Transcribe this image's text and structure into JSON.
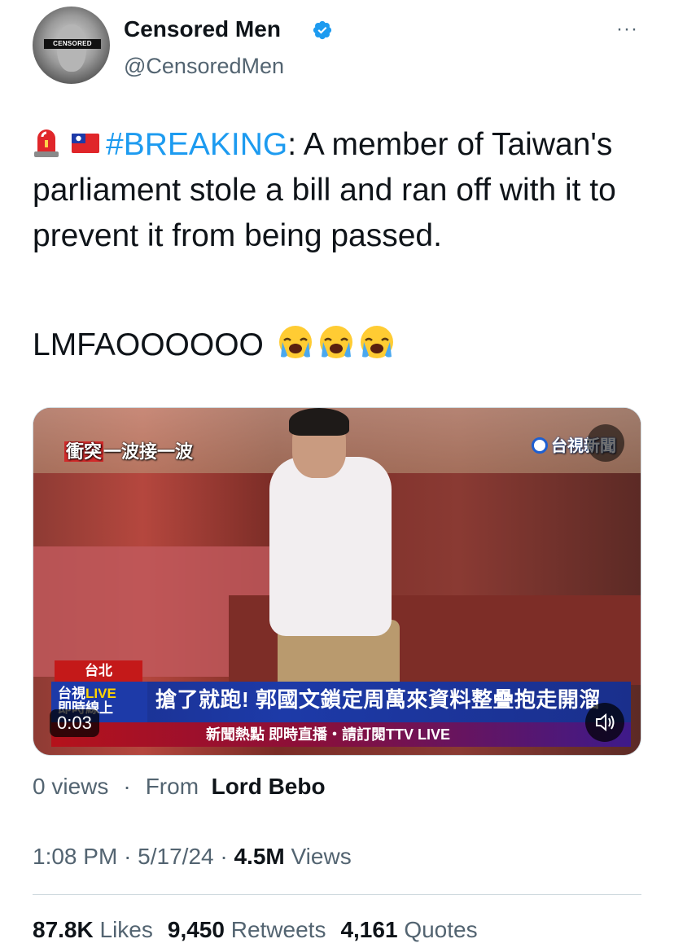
{
  "author": {
    "display_name": "Censored Men",
    "handle": "@CensoredMen",
    "avatar_band_text": "CENSORED",
    "verified": true,
    "more_label": "···"
  },
  "tweet": {
    "hashtag": "#BREAKING",
    "body": ": A member of Taiwan's parliament stole a bill and ran off with it to prevent it from being passed.",
    "line2": "LMFAOOOOOO",
    "emojis": [
      "siren-emoji",
      "taiwan-flag-emoji",
      "loudly-crying-emoji",
      "loudly-crying-emoji",
      "loudly-crying-emoji"
    ]
  },
  "video": {
    "overlay_top_left": "衝突一波接一波",
    "overlay_top_left_highlight": "衝突",
    "overlay_top_left_rest": "一波接一波",
    "channel_logo": "台視新聞",
    "city_tag": "台北",
    "live_label_top": "台視",
    "live_label_live": "LIVE",
    "live_label_bottom": "即時線上",
    "headline": "搶了就跑! 郭國文鎖定周萬來資料整疊抱走開溜",
    "subline": "新聞熱點 即時直播・請訂閱TTV LIVE",
    "timer": "0:03"
  },
  "meta": {
    "views_label": "0 views",
    "dot": "·",
    "from_label": "From",
    "source_name": "Lord Bebo"
  },
  "timestamp": {
    "time": "1:08 PM",
    "sep": "·",
    "date": "5/17/24",
    "views_count": "4.5M",
    "views_word": "Views"
  },
  "stats": {
    "likes_count": "87.8K",
    "likes_word": "Likes",
    "retweets_count": "9,450",
    "retweets_word": "Retweets",
    "quotes_count": "4,161",
    "quotes_word": "Quotes"
  },
  "colors": {
    "accent": "#1d9bf0",
    "text": "#0f1419",
    "secondary": "#536471",
    "divider": "#cfd9de"
  }
}
